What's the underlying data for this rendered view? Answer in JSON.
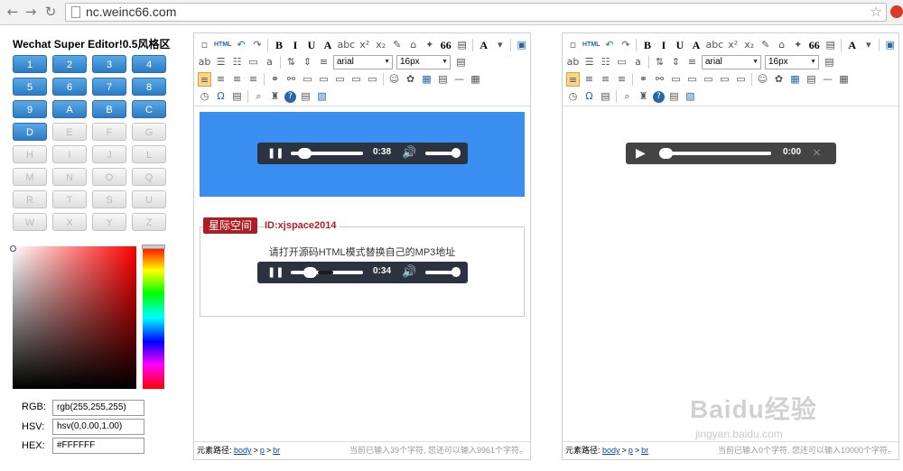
{
  "browser": {
    "url": "nc.weinc66.com",
    "back_icon": "back-arrow-icon",
    "forward_icon": "forward-arrow-icon",
    "reload_icon": "reload-icon",
    "bookmark_icon": "star-icon"
  },
  "left_panel": {
    "title": "Wechat Super Editor!0.5风格区",
    "buttons": [
      "1",
      "2",
      "3",
      "4",
      "5",
      "6",
      "7",
      "8",
      "9",
      "A",
      "B",
      "C",
      "D",
      "E",
      "F",
      "G",
      "H",
      "I",
      "J",
      "L",
      "M",
      "N",
      "O",
      "Q",
      "R",
      "T",
      "S",
      "U",
      "W",
      "X",
      "Y",
      "Z"
    ],
    "active_count": 13,
    "colors": {
      "active_button": "#2b7cc4",
      "inactive_button": "#dedede"
    },
    "color_picker": {
      "rgb_label": "RGB:",
      "rgb_value": "rgb(255,255,255)",
      "hsv_label": "HSV:",
      "hsv_value": "hsv(0,0.00,1.00)",
      "hex_label": "HEX:",
      "hex_value": "#FFFFFF"
    }
  },
  "toolbar": {
    "font_family": "arial",
    "font_size": "16px",
    "html_label": "HTML",
    "quote_label": "66",
    "font_color_label": "A",
    "icons_row1": [
      "source-icon",
      "html-icon",
      "undo-icon",
      "redo-icon",
      "bold-icon",
      "italic-icon",
      "underline-icon",
      "font-border-icon",
      "strikethrough-icon",
      "superscript-icon",
      "subscript-icon",
      "eraser-icon",
      "format-brush-icon",
      "auto-format-icon",
      "blockquote-icon",
      "paste-text-icon",
      "font-color-icon",
      "fullscreen-icon"
    ],
    "icons_row2": [
      "row-spacing-icon",
      "ordered-list-icon",
      "unordered-list-icon",
      "line-height-icon",
      "text-indent-icon",
      "paragraph-icon"
    ],
    "icons_row3": [
      "align-left-icon",
      "align-center-icon",
      "align-right-icon",
      "align-justify-icon",
      "link-icon",
      "unlink-icon",
      "anchor-icon",
      "image-icon",
      "emotion-icon",
      "insert-table-icon",
      "horizontal-rule-icon",
      "date-icon"
    ],
    "icons_row4": [
      "time-icon",
      "omega-icon",
      "template-icon",
      "search-replace-icon",
      "preview-icon",
      "help-icon",
      "paste-plain-icon",
      "background-icon"
    ]
  },
  "editor_left": {
    "player1": {
      "time": "0:38",
      "progress": 0.1,
      "volume": 0.8
    },
    "badge": "星际空间",
    "id_text": "ID:xjspace2014",
    "card_text": "请打开源码HTML模式替换自己的MP3地址",
    "player2": {
      "time": "0:34",
      "progress": 0.17,
      "volume": 0.8
    },
    "status_path_label": "元素路径:",
    "path": [
      "body",
      "p",
      "br"
    ],
    "path_separator": ">",
    "count_text": "当前已输入39个字符, 您还可以输入9961个字符。",
    "colors": {
      "banner": "#3a8ef0",
      "badge": "#b01e23"
    }
  },
  "editor_right": {
    "player": {
      "time": "0:00",
      "progress": 0.0,
      "muted": true
    },
    "status_path_label": "元素路径:",
    "path": [
      "body",
      "p",
      "br"
    ],
    "path_separator": ">",
    "count_text": "当前已输入0个字符, 您还可以输入10000个字符。"
  },
  "watermark": {
    "text": "Baidu经验",
    "sub": "jingyan.baidu.com"
  }
}
